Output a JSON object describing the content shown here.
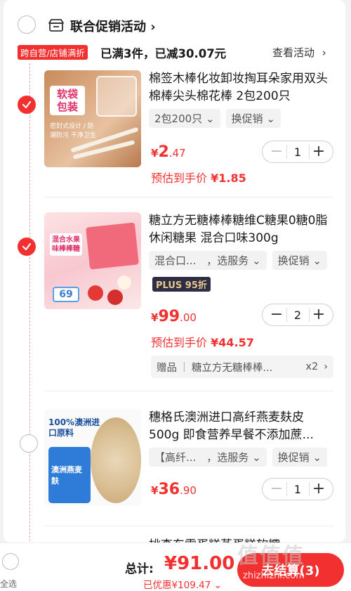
{
  "header": {
    "title": "联合促销活动",
    "chevron": "chevron-right-icon"
  },
  "promo": {
    "tag": "跨自营/店铺满折",
    "text": "已满3件，已减30.07元",
    "view_link": "查看活动"
  },
  "items": [
    {
      "name": "棉签木棒化妆卸妆掏耳朵家用双头棉棒尖头棉花棒 2包200只",
      "checked": true,
      "chips": [
        "2包200只",
        "换促销"
      ],
      "price_cur": "¥",
      "price_int": "2",
      "price_dec": ".47",
      "est_label": "预估到手价",
      "est_value": "¥1.85",
      "qty": "1",
      "thumb_text": "软袋包装",
      "thumb_sub": "密封式设计 / 防潮防污 干净卫生"
    },
    {
      "name": "糖立方无糖棒棒糖维C糖果0糖0脂休闲糖果 混合口味300g",
      "checked": true,
      "chips": [
        "混合口...　，选服务",
        "换促销"
      ],
      "badge": "PLUS 95折",
      "price_cur": "¥",
      "price_int": "99",
      "price_dec": ".00",
      "est_label": "预估到手价",
      "est_value": "¥44.57",
      "qty": "2",
      "gift_label": "赠品",
      "gift_name": "糖立方无糖棒棒...",
      "gift_qty": "x2",
      "thumb_text": "混合水果味棒棒糖",
      "thumb_sub": "69"
    },
    {
      "name": "穗格氏澳洲进口高纤燕麦麸皮500g 即食营养早餐不添加蔗...",
      "checked": false,
      "chips": [
        "【高纤...　，选服务",
        "换促销"
      ],
      "price_cur": "¥",
      "price_int": "36",
      "price_dec": ".90",
      "qty": "1",
      "thumb_text": "100%澳洲进口原料",
      "thumb_sub": "澳洲燕麦麸"
    },
    {
      "name": "桃李东雷蛋糕蒸蛋糕软糯"
    }
  ],
  "footer": {
    "select_all": "全选",
    "total_label": "总计:",
    "total_value": "¥91.00",
    "saved": "已优惠¥109.47",
    "checkout": "去结算(3)",
    "watermark": "值值值",
    "watermark_sub": "zhizhizhi.com"
  },
  "colors": {
    "accent": "#f23030",
    "plus_bg": "#2d2d45",
    "plus_fg": "#e8c98b"
  }
}
